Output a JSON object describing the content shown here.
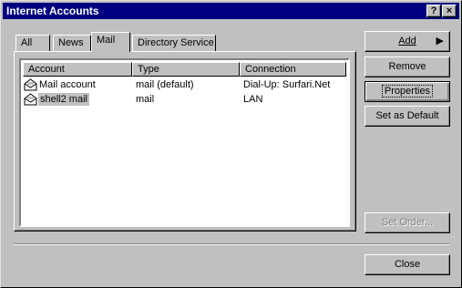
{
  "window": {
    "title": "Internet Accounts",
    "help_glyph": "?",
    "close_glyph": "×"
  },
  "tabs": [
    "All",
    "News",
    "Mail",
    "Directory Service"
  ],
  "active_tab": "Mail",
  "list": {
    "headers": [
      "Account",
      "Type",
      "Connection"
    ],
    "rows": [
      {
        "account": "Mail account",
        "type": "mail (default)",
        "connection": "Dial-Up: Surfari.Net",
        "icon": "mail-account-icon"
      },
      {
        "account": "shell2 mail",
        "type": "mail",
        "connection": "LAN",
        "icon": "mail-account-icon",
        "selected": true
      }
    ]
  },
  "buttons": {
    "add": "Add",
    "remove": "Remove",
    "properties": "Properties",
    "set_default": "Set as Default",
    "set_order": "Set Order...",
    "close": "Close"
  },
  "colors": {
    "titlebar": "#000080",
    "face": "#c0c0c0",
    "selection": "#c0c0c0"
  }
}
